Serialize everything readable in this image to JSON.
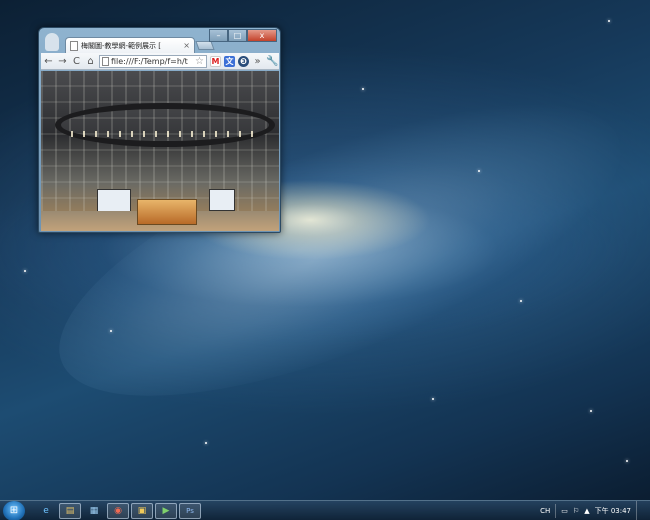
{
  "window": {
    "tab_title": "梅閣圖-教學網-範例展示 [",
    "tab_close": "×",
    "controls": {
      "minimize": "–",
      "maximize": "□",
      "close": "x"
    },
    "toolbar": {
      "back": "←",
      "forward": "→",
      "reload": "C",
      "home": "⌂",
      "url": "file:///F:/Temp/f=h/t",
      "star": "☆",
      "menu": "»",
      "wrench": "🔧"
    },
    "extensions": [
      {
        "name": "gmail-icon",
        "label": "M"
      },
      {
        "name": "translate-icon",
        "label": "文"
      },
      {
        "name": "extension-circle-icon",
        "label": "❸"
      }
    ]
  },
  "taskbar": {
    "start_label": "⊞",
    "apps": [
      {
        "name": "ie-icon",
        "label": "e",
        "open": false,
        "color": "#3d8bd8"
      },
      {
        "name": "explorer-window-icon",
        "label": "▤",
        "open": true,
        "color": "#c9a24a"
      },
      {
        "name": "notes-icon",
        "label": "▦",
        "open": false,
        "color": "#6aa7d8"
      },
      {
        "name": "chrome-icon",
        "label": "◉",
        "open": true,
        "color": "#d84c3a"
      },
      {
        "name": "folder-icon",
        "label": "▣",
        "open": true,
        "color": "#e0b64f"
      },
      {
        "name": "media-icon",
        "label": "▶",
        "open": true,
        "color": "#5aa94e"
      },
      {
        "name": "ps-icon",
        "label": "Ps",
        "open": true,
        "color": "#2b5ea8"
      }
    ],
    "tray": {
      "ime": "CH",
      "icons": [
        "▭",
        "⚐",
        "▲"
      ],
      "clock": "下午 03:47"
    }
  }
}
